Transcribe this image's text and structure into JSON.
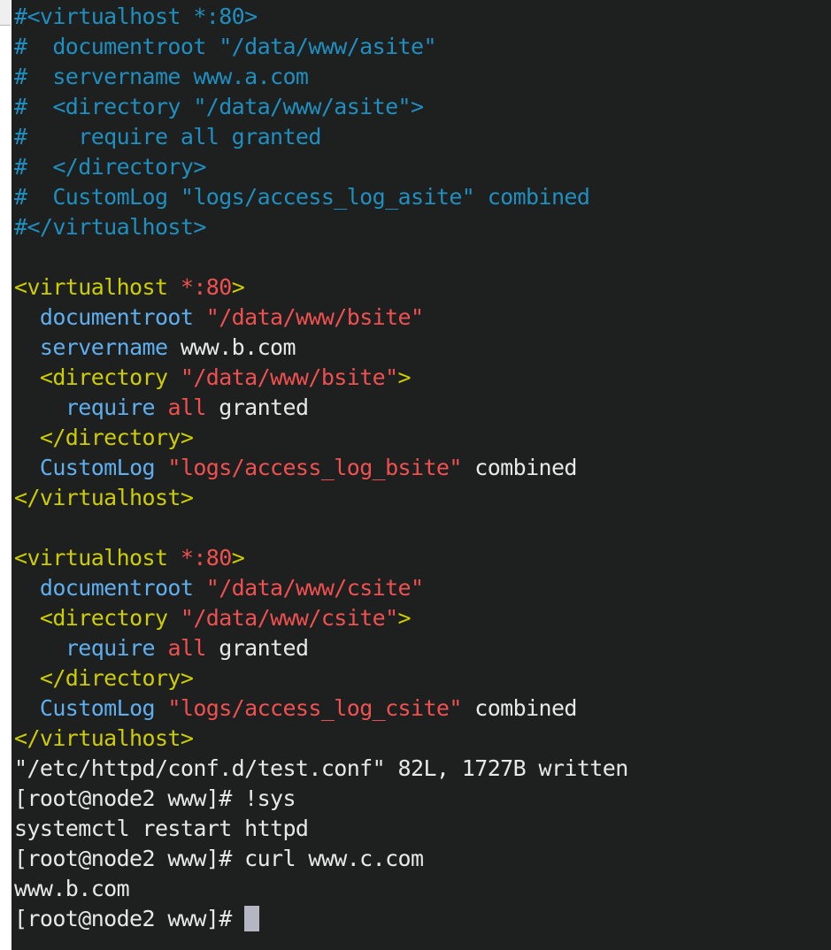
{
  "window": {
    "background_color": "#1e1f1f",
    "scrollbar_color": "#efefef",
    "cursor_color": "#b4b6c4"
  },
  "palette": {
    "comment": "#1f8fc0",
    "tag": "#cdcd00",
    "directive": "#5fafef",
    "string": "#f05050",
    "plain": "#e8e8e8"
  },
  "terminal": {
    "lines": [
      {
        "id": "l01",
        "segments": [
          {
            "t": "#<",
            "c": "comment"
          },
          {
            "t": "virtualhost *:80>",
            "c": "comment"
          }
        ]
      },
      {
        "id": "l02",
        "segments": [
          {
            "t": "#  documentroot \"/data/www/asite\"",
            "c": "comment"
          }
        ]
      },
      {
        "id": "l03",
        "segments": [
          {
            "t": "#  servername www.a.com",
            "c": "comment"
          }
        ]
      },
      {
        "id": "l04",
        "segments": [
          {
            "t": "#  <directory \"/data/www/asite\">",
            "c": "comment"
          }
        ]
      },
      {
        "id": "l05",
        "segments": [
          {
            "t": "#    require all granted",
            "c": "comment"
          }
        ]
      },
      {
        "id": "l06",
        "segments": [
          {
            "t": "#  </directory>",
            "c": "comment"
          }
        ]
      },
      {
        "id": "l07",
        "segments": [
          {
            "t": "#  CustomLog \"logs/access_log_asite\" combined",
            "c": "comment"
          }
        ]
      },
      {
        "id": "l08",
        "segments": [
          {
            "t": "#</virtualhost>",
            "c": "comment"
          }
        ]
      },
      {
        "id": "l09",
        "segments": [
          {
            "t": "",
            "c": "plain"
          }
        ]
      },
      {
        "id": "l10",
        "segments": [
          {
            "t": "<virtualhost ",
            "c": "tag"
          },
          {
            "t": "*:80",
            "c": "string"
          },
          {
            "t": ">",
            "c": "tag"
          }
        ]
      },
      {
        "id": "l11",
        "segments": [
          {
            "t": "  ",
            "c": "plain"
          },
          {
            "t": "documentroot",
            "c": "directive"
          },
          {
            "t": " ",
            "c": "plain"
          },
          {
            "t": "\"/data/www/bsite\"",
            "c": "string"
          }
        ]
      },
      {
        "id": "l12",
        "segments": [
          {
            "t": "  ",
            "c": "plain"
          },
          {
            "t": "servername",
            "c": "directive"
          },
          {
            "t": " ",
            "c": "plain"
          },
          {
            "t": "www.b.com",
            "c": "plain"
          }
        ]
      },
      {
        "id": "l13",
        "segments": [
          {
            "t": "  ",
            "c": "plain"
          },
          {
            "t": "<directory ",
            "c": "tag"
          },
          {
            "t": "\"/data/www/bsite\"",
            "c": "string"
          },
          {
            "t": ">",
            "c": "tag"
          }
        ]
      },
      {
        "id": "l14",
        "segments": [
          {
            "t": "    ",
            "c": "plain"
          },
          {
            "t": "require",
            "c": "directive"
          },
          {
            "t": " ",
            "c": "plain"
          },
          {
            "t": "all",
            "c": "string"
          },
          {
            "t": " granted",
            "c": "plain"
          }
        ]
      },
      {
        "id": "l15",
        "segments": [
          {
            "t": "  ",
            "c": "plain"
          },
          {
            "t": "</directory>",
            "c": "tag"
          }
        ]
      },
      {
        "id": "l16",
        "segments": [
          {
            "t": "  ",
            "c": "plain"
          },
          {
            "t": "CustomLog",
            "c": "directive"
          },
          {
            "t": " ",
            "c": "plain"
          },
          {
            "t": "\"logs/access_log_bsite\"",
            "c": "string"
          },
          {
            "t": " combined",
            "c": "plain"
          }
        ]
      },
      {
        "id": "l17",
        "segments": [
          {
            "t": "</virtualhost>",
            "c": "tag"
          }
        ]
      },
      {
        "id": "l18",
        "segments": [
          {
            "t": "",
            "c": "plain"
          }
        ]
      },
      {
        "id": "l19",
        "segments": [
          {
            "t": "<virtualhost ",
            "c": "tag"
          },
          {
            "t": "*:80",
            "c": "string"
          },
          {
            "t": ">",
            "c": "tag"
          }
        ]
      },
      {
        "id": "l20",
        "segments": [
          {
            "t": "  ",
            "c": "plain"
          },
          {
            "t": "documentroot",
            "c": "directive"
          },
          {
            "t": " ",
            "c": "plain"
          },
          {
            "t": "\"/data/www/csite\"",
            "c": "string"
          }
        ]
      },
      {
        "id": "l21",
        "segments": [
          {
            "t": "  ",
            "c": "plain"
          },
          {
            "t": "<directory ",
            "c": "tag"
          },
          {
            "t": "\"/data/www/csite\"",
            "c": "string"
          },
          {
            "t": ">",
            "c": "tag"
          }
        ]
      },
      {
        "id": "l22",
        "segments": [
          {
            "t": "    ",
            "c": "plain"
          },
          {
            "t": "require",
            "c": "directive"
          },
          {
            "t": " ",
            "c": "plain"
          },
          {
            "t": "all",
            "c": "string"
          },
          {
            "t": " granted",
            "c": "plain"
          }
        ]
      },
      {
        "id": "l23",
        "segments": [
          {
            "t": "  ",
            "c": "plain"
          },
          {
            "t": "</directory>",
            "c": "tag"
          }
        ]
      },
      {
        "id": "l24",
        "segments": [
          {
            "t": "  ",
            "c": "plain"
          },
          {
            "t": "CustomLog",
            "c": "directive"
          },
          {
            "t": " ",
            "c": "plain"
          },
          {
            "t": "\"logs/access_log_csite\"",
            "c": "string"
          },
          {
            "t": " combined",
            "c": "plain"
          }
        ]
      },
      {
        "id": "l25",
        "segments": [
          {
            "t": "</virtualhost>",
            "c": "tag"
          }
        ]
      },
      {
        "id": "l26",
        "segments": [
          {
            "t": "\"/etc/httpd/conf.d/test.conf\" 82L, 1727B written",
            "c": "plain"
          }
        ]
      },
      {
        "id": "l27",
        "segments": [
          {
            "t": "[root@node2 www]# !sys",
            "c": "plain"
          }
        ]
      },
      {
        "id": "l28",
        "segments": [
          {
            "t": "systemctl restart httpd",
            "c": "plain"
          }
        ]
      },
      {
        "id": "l29",
        "segments": [
          {
            "t": "[root@node2 www]# curl www.c.com",
            "c": "plain"
          }
        ]
      },
      {
        "id": "l30",
        "segments": [
          {
            "t": "www.b.com",
            "c": "plain"
          }
        ]
      },
      {
        "id": "l31",
        "segments": [
          {
            "t": "[root@node2 www]# ",
            "c": "plain"
          }
        ],
        "cursor": true
      }
    ],
    "status_line": "\"/etc/httpd/conf.d/test.conf\" 82L, 1727B written",
    "prompt": "[root@node2 www]#",
    "commands": [
      "!sys",
      "systemctl restart httpd",
      "curl www.c.com"
    ],
    "command_output": "www.b.com"
  }
}
